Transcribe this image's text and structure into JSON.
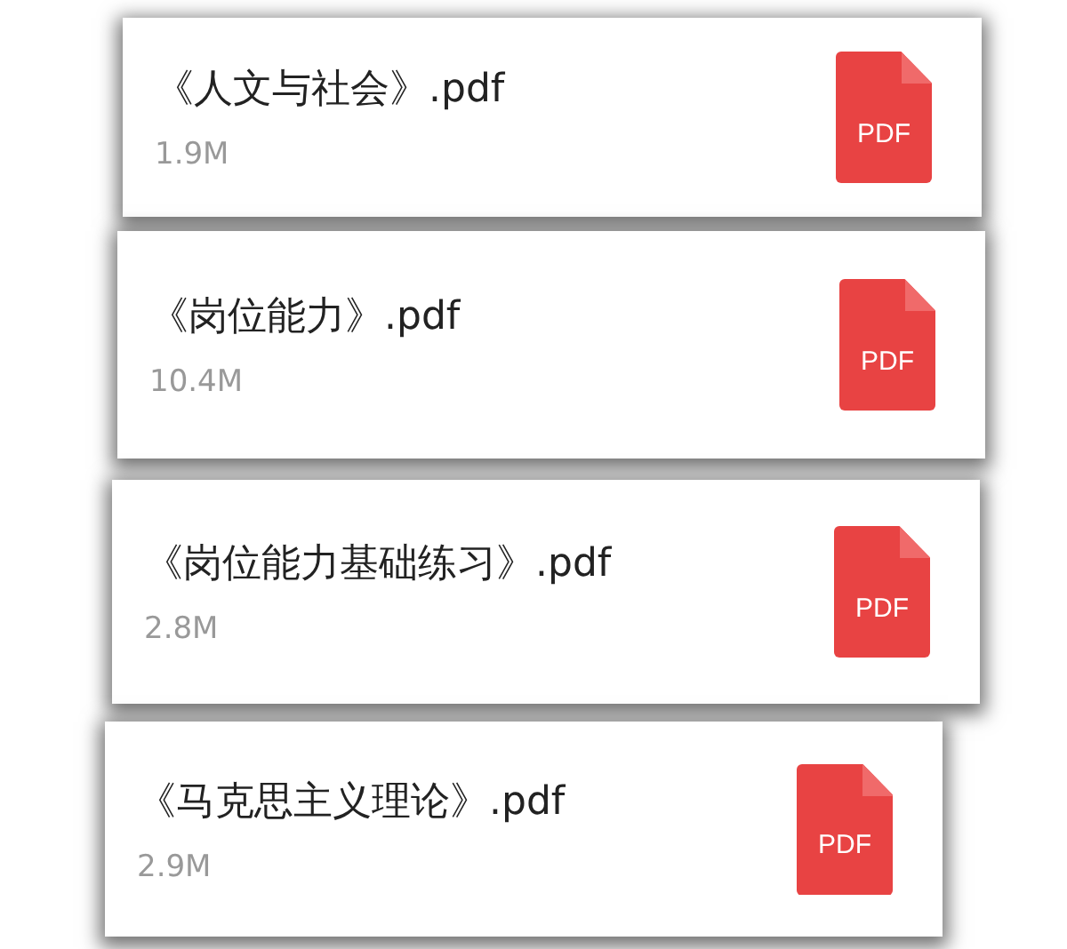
{
  "files": [
    {
      "name": "《人文与社会》.pdf",
      "size": "1.9M",
      "badge": "PDF"
    },
    {
      "name": "《岗位能力》.pdf",
      "size": "10.4M",
      "badge": "PDF"
    },
    {
      "name": "《岗位能力基础练习》.pdf",
      "size": "2.8M",
      "badge": "PDF"
    },
    {
      "name": "《马克思主义理论》.pdf",
      "size": "2.9M",
      "badge": "PDF"
    }
  ]
}
